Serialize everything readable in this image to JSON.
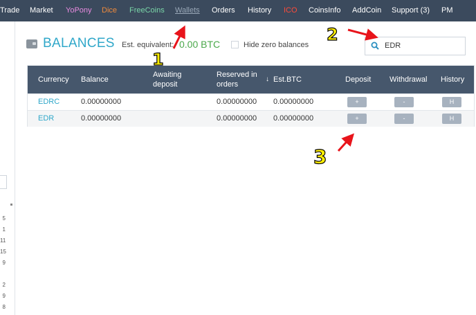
{
  "nav": {
    "items": [
      {
        "label": "Trade",
        "color": "#ffffff"
      },
      {
        "label": "Market",
        "color": "#ffffff"
      },
      {
        "label": "YoPony",
        "color": "#e98be0"
      },
      {
        "label": "Dice",
        "color": "#f08a3c"
      },
      {
        "label": "FreeCoins",
        "color": "#7ad6a8"
      },
      {
        "label": "Wallets",
        "color": "#9aa8b8"
      },
      {
        "label": "Orders",
        "color": "#ffffff"
      },
      {
        "label": "History",
        "color": "#ffffff"
      },
      {
        "label": "ICO",
        "color": "#ff4a3a"
      },
      {
        "label": "CoinsInfo",
        "color": "#ffffff"
      },
      {
        "label": "AddCoin",
        "color": "#ffffff"
      },
      {
        "label": "Support (3)",
        "color": "#ffffff"
      },
      {
        "label": "PM",
        "color": "#ffffff"
      }
    ]
  },
  "sidebar": {
    "numbers": [
      "5",
      "1",
      "11",
      "15",
      "9",
      "",
      "2",
      "9",
      "8"
    ]
  },
  "balances": {
    "title": "BALANCES",
    "est_label": "Est. equivalent:",
    "est_value": "0.00 BTC",
    "hide_zero_label": "Hide zero balances",
    "search_value": "EDR"
  },
  "table": {
    "headers": {
      "currency": "Currency",
      "balance": "Balance",
      "awaiting_1": "Awaiting",
      "awaiting_2": "deposit",
      "reserved_1": "Reserved in",
      "reserved_2": "orders",
      "est_btc": "Est.BTC",
      "sort_glyph": "↓",
      "deposit": "Deposit",
      "withdrawal": "Withdrawal",
      "history": "History"
    },
    "rows": [
      {
        "currency": "EDRC",
        "balance": "0.00000000",
        "reserved": "0.00000000",
        "est_btc": "0.00000000",
        "deposit": "+",
        "withdrawal": "-",
        "history": "H"
      },
      {
        "currency": "EDR",
        "balance": "0.00000000",
        "reserved": "0.00000000",
        "est_btc": "0.00000000",
        "deposit": "+",
        "withdrawal": "-",
        "history": "H"
      }
    ]
  },
  "annotations": {
    "one": "1",
    "two": "2",
    "three": "3",
    "arrow_color": "#e8141b",
    "number_color": "#ffee00"
  }
}
